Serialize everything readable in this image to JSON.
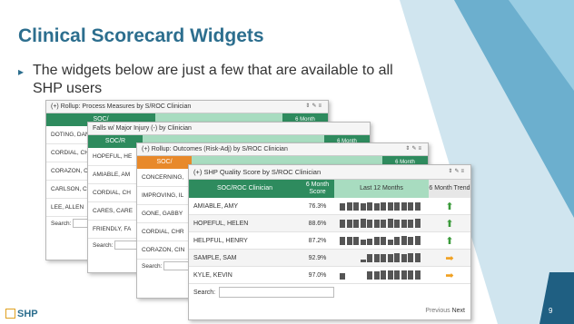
{
  "slide": {
    "title": "Clinical Scorecard Widgets",
    "bullet": "The widgets below are just a few that are available to all SHP users",
    "page_number": "9",
    "logo_text": "SHP"
  },
  "colors": {
    "title": "#2c6e8e",
    "header_green": "#2e8b5e",
    "header_light_green": "#a8dcc0",
    "header_orange": "#e8892a",
    "trend_up": "#3a9a3a",
    "trend_flat": "#f0a020"
  },
  "widgets": {
    "w1": {
      "title": "(+) Rollup: Process Measures by S/ROC Clinician",
      "header_col1": "SOC/",
      "header_col2": "6 Month",
      "rows": [
        "DOTING, DAN",
        "CORDIAL, CH",
        "CORAZON, C",
        "CARLSON, C",
        "LEE, ALLEN"
      ],
      "search_label": "Search:"
    },
    "w2": {
      "title": "Falls w/ Major Injury (-) by Clinician",
      "header_col1": "SOC/R",
      "header_col2": "6 Month",
      "rows": [
        "HOPEFUL, HE",
        "AMIABLE, AM",
        "CORDIAL, CH",
        "CARES, CARE",
        "FRIENDLY, FA"
      ],
      "search_label": "Search:"
    },
    "w3": {
      "title": "(+) Rollup: Outcomes (Risk-Adj) by S/ROC Clinician",
      "header_col1": "SOC/",
      "header_col2": "6 Month",
      "rows": [
        "CONCERNING,",
        "IMPROVING, IL",
        "GONE, GABBY",
        "CORDIAL, CHR",
        "CORAZON, CIN"
      ],
      "search_label": "Search:"
    },
    "main": {
      "title": "(+) SHP Quality Score by S/ROC Clinician",
      "headers": {
        "clinician": "SOC/ROC Clinician",
        "score": "6 Month Score",
        "last12": "Last 12 Months",
        "trend": "6 Month Trend"
      },
      "rows": [
        {
          "name": "AMIABLE, AMY",
          "score": "76.3%",
          "trend": "up",
          "bars": [
            0.7,
            0.8,
            0.8,
            0.75,
            0.8,
            0.7,
            0.8,
            0.85,
            0.8,
            0.85,
            0.8,
            0.85
          ]
        },
        {
          "name": "HOPEFUL, HELEN",
          "score": "88.6%",
          "trend": "up",
          "bars": [
            0.85,
            0.85,
            0.85,
            0.9,
            0.85,
            0.85,
            0.85,
            0.9,
            0.85,
            0.85,
            0.85,
            0.9
          ]
        },
        {
          "name": "HELPFUL, HENRY",
          "score": "87.2%",
          "trend": "up",
          "bars": [
            0.85,
            0.85,
            0.8,
            0.55,
            0.6,
            0.85,
            0.85,
            0.55,
            0.85,
            0.9,
            0.85,
            0.9
          ]
        },
        {
          "name": "SAMPLE, SAM",
          "score": "92.9%",
          "trend": "flat",
          "bars": [
            0,
            0,
            0,
            0.3,
            0.85,
            0.85,
            0.85,
            0.85,
            0.9,
            0.85,
            0.9,
            0.9
          ]
        },
        {
          "name": "KYLE, KEVIN",
          "score": "97.0%",
          "trend": "flat",
          "bars": [
            0.6,
            0,
            0,
            0,
            0.8,
            0.85,
            0.9,
            0.9,
            0.9,
            0.9,
            0.9,
            0.95
          ]
        }
      ],
      "search_label": "Search:",
      "pager_prev": "Previous",
      "pager_next": "Next"
    }
  },
  "icons": {
    "tools": [
      "sort-icon",
      "edit-icon",
      "menu-icon"
    ],
    "bullet": "triangle-bullet-icon"
  }
}
